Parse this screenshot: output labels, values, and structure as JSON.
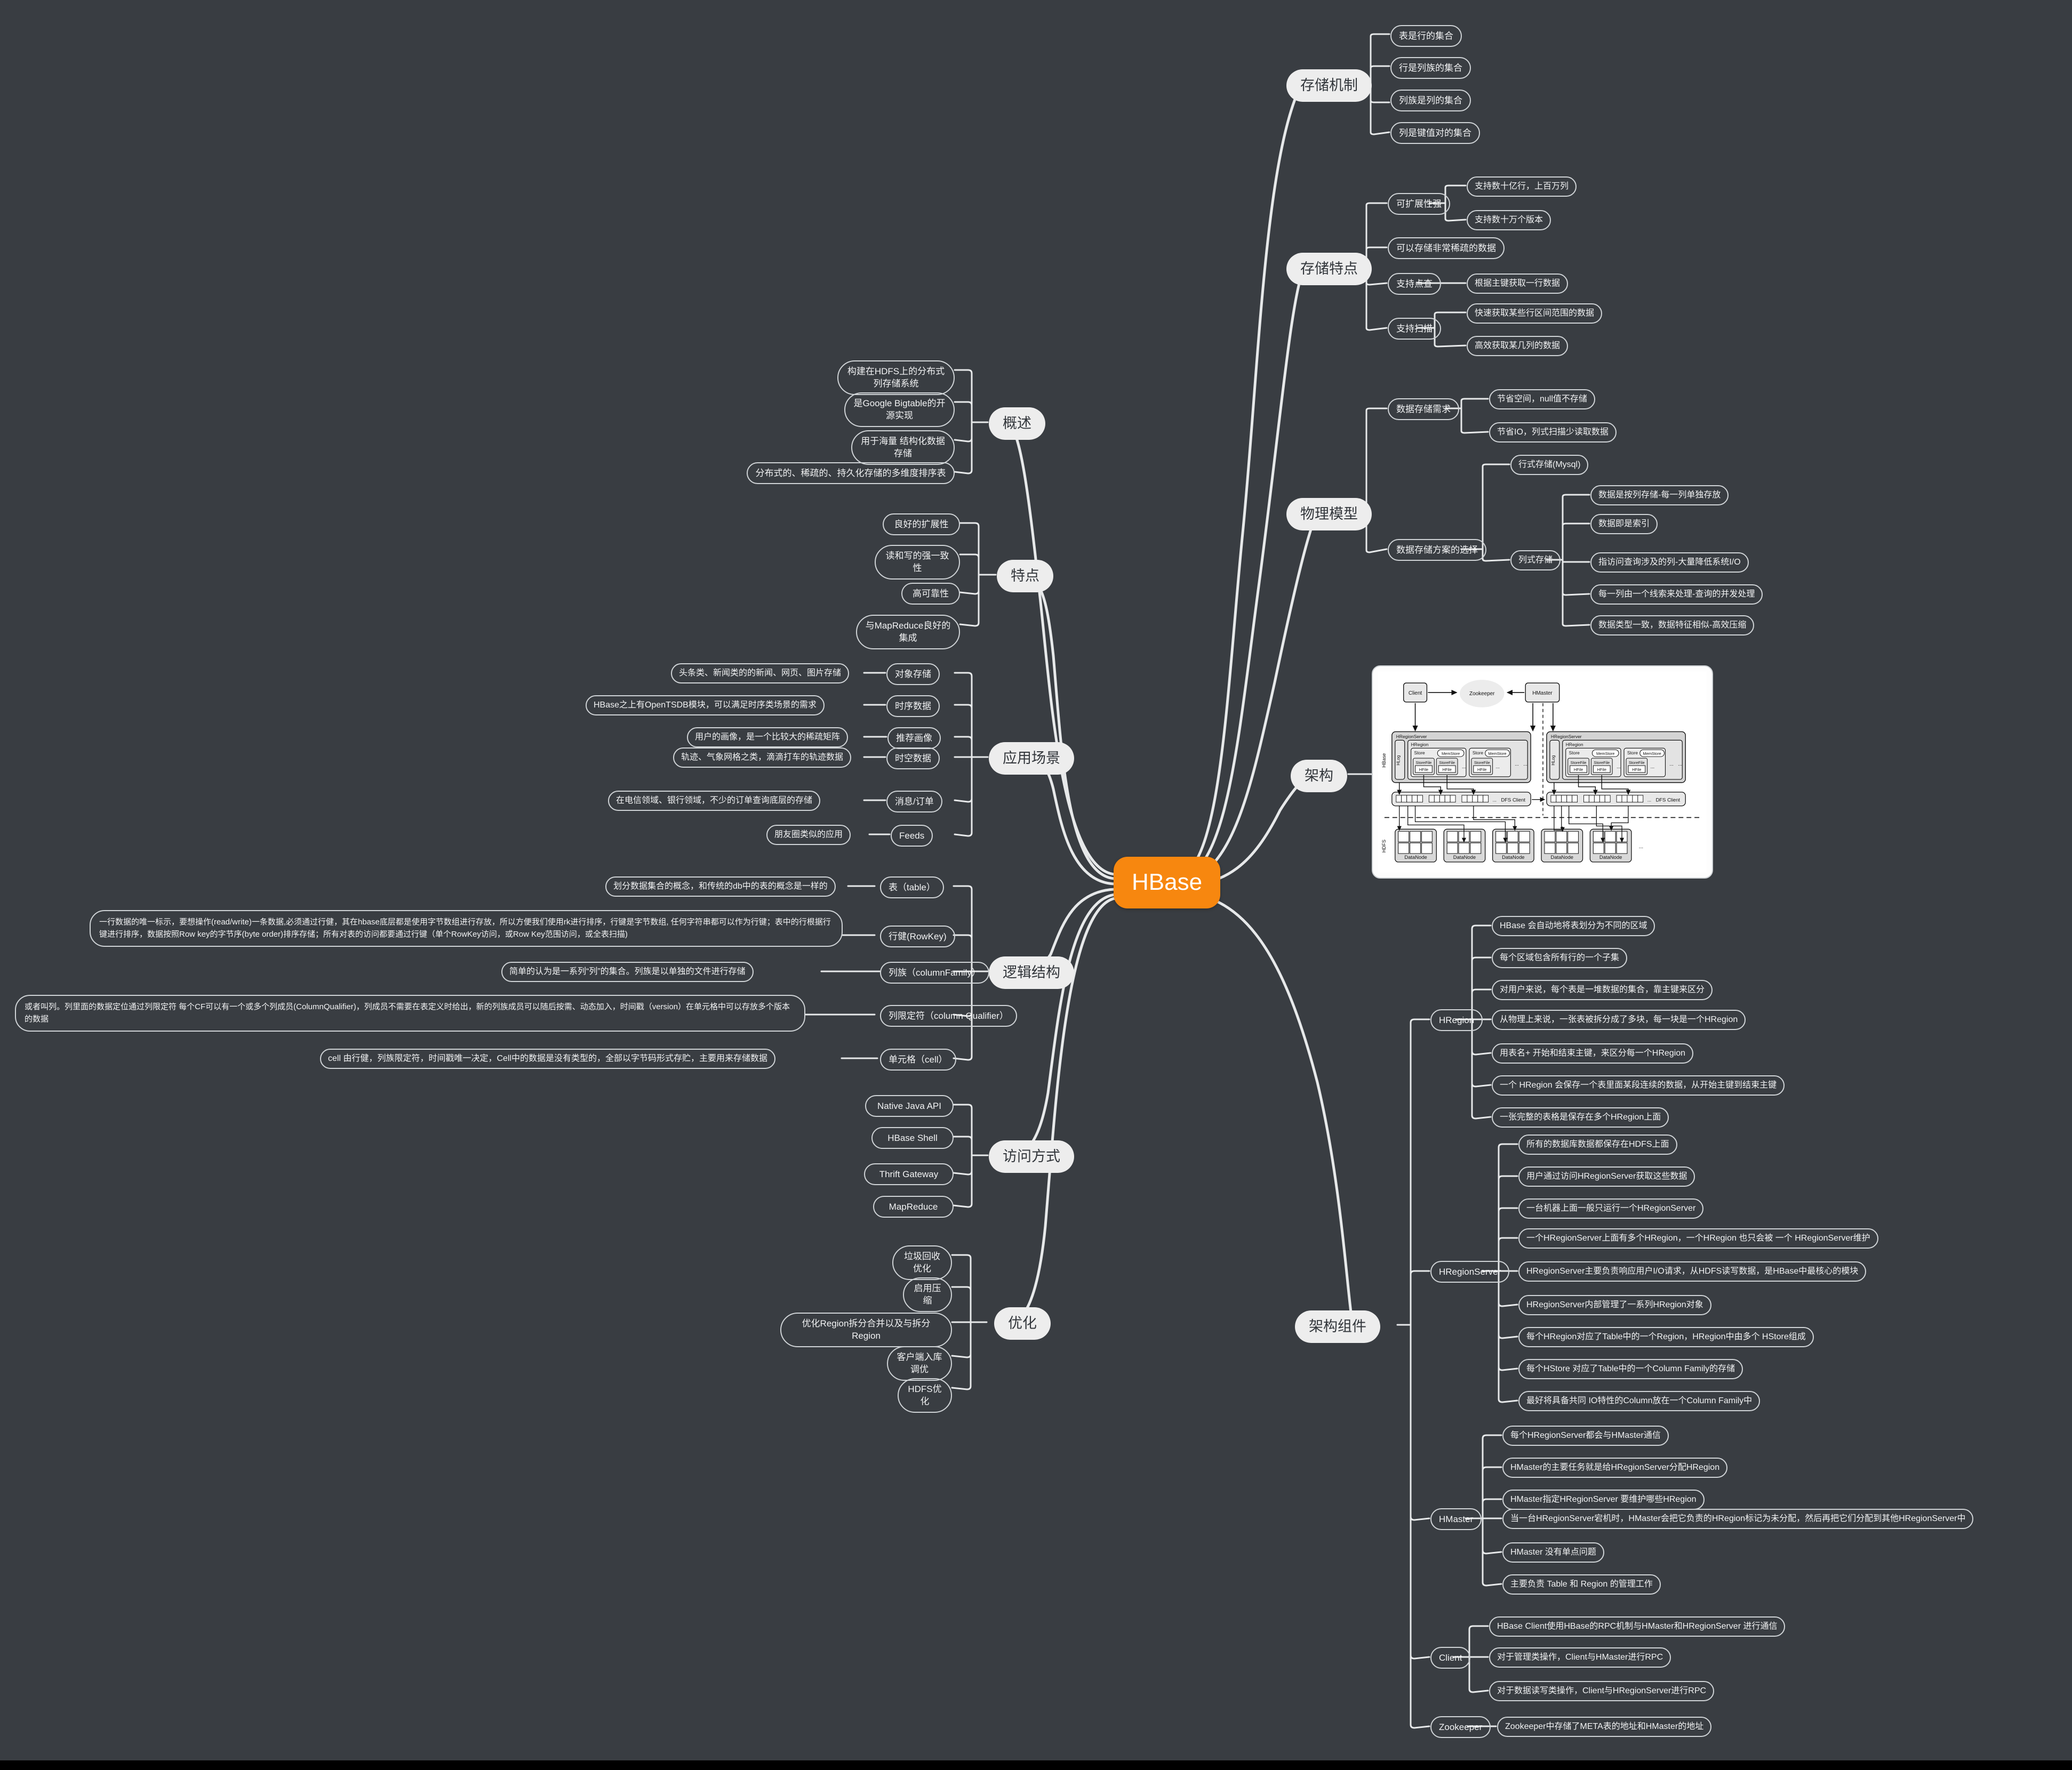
{
  "theme": {
    "canvas_bg": "#393d42",
    "root_color": "#f7870f",
    "level1_bg": "#ededed",
    "line_color": "#e7e9ea",
    "text_color": "#f2f3f4"
  },
  "root": {
    "label": "HBase"
  },
  "branches": {
    "storage_mechanism": {
      "label": "存储机制",
      "children": [
        "表是行的集合",
        "行是列族的集合",
        "列族是列的集合",
        "列是键值对的集合"
      ]
    },
    "storage_features": {
      "label": "存储特点",
      "children": [
        {
          "label": "可扩展性强",
          "children": [
            "支持数十亿行，上百万列",
            "支持数十万个版本"
          ]
        },
        {
          "label": "可以存储非常稀疏的数据",
          "children": []
        },
        {
          "label": "支持点查",
          "children": [
            "根据主键获取一行数据"
          ]
        },
        {
          "label": "支持扫描",
          "children": [
            "快速获取某些行区间范围的数据",
            "高效获取某几列的数据"
          ]
        }
      ]
    },
    "physical_model": {
      "label": "物理模型",
      "children": [
        {
          "label": "数据存储需求",
          "children": [
            "节省空间，null值不存储",
            "节省IO，列式扫描少读取数据"
          ]
        },
        {
          "label": "数据存储方案的选择",
          "children": [
            {
              "label": "行式存储(Mysql)",
              "children": []
            },
            {
              "label": "列式存储",
              "children": [
                "数据是按列存储-每一列单独存放",
                "数据即是索引",
                "指访问查询涉及的列-大量降低系统I/O",
                "每一列由一个线索来处理-查询的并发处理",
                "数据类型一致，数据特征相似-高效压缩"
              ]
            }
          ]
        }
      ]
    },
    "architecture": {
      "label": "架构",
      "diagram": {
        "name": "hbase-architecture-diagram",
        "nodes": [
          "Client",
          "Zookeeper",
          "HMaster",
          "HRegionServer",
          "HRegion",
          "HLog",
          "Store",
          "MemStore",
          "StoreFile",
          "HFile",
          "DFS Client",
          "DataNode"
        ],
        "side_labels": [
          "HBase",
          "HDFS"
        ],
        "ellipsis": "..."
      }
    },
    "architecture_components": {
      "label": "架构组件",
      "children": [
        {
          "label": "HRegion",
          "children": [
            "HBase 会自动地将表划分为不同的区域",
            "每个区域包含所有行的一个子集",
            "对用户来说，每个表是一堆数据的集合，靠主键来区分",
            "从物理上来说，一张表被拆分成了多块，每一块是一个HRegion",
            "用表名+ 开始和结束主键，来区分每一个HRegion",
            "一个 HRegion 会保存一个表里面某段连续的数据，从开始主键到结束主键",
            "一张完整的表格是保存在多个HRegion上面"
          ]
        },
        {
          "label": "HRegionServer",
          "children": [
            "所有的数据库数据都保存在HDFS上面",
            "用户通过访问HRegionServer获取这些数据",
            "一台机器上面一般只运行一个HRegionServer",
            "一个HRegionServer上面有多个HRegion，一个HRegion 也只会被 一个 HRegionServer维护",
            "HRegionServer主要负责响应用户I/O请求，从HDFS读写数据，是HBase中最核心的模块",
            "HRegionServer内部管理了一系列HRegion对象",
            "每个HRegion对应了Table中的一个Region，HRegion中由多个 HStore组成",
            "每个HStore 对应了Table中的一个Column Family的存储",
            "最好将具备共同 IO特性的Column放在一个Column Family中"
          ]
        },
        {
          "label": "HMaster",
          "children": [
            "每个HRegionServer都会与HMaster通信",
            "HMaster的主要任务就是给HRegionServer分配HRegion",
            "HMaster指定HRegionServer 要维护哪些HRegion",
            "当一台HRegionServer宕机时，HMaster会把它负责的HRegion标记为未分配，然后再把它们分配到其他HRegionServer中",
            "HMaster 没有单点问题",
            "主要负责 Table 和 Region 的管理工作"
          ]
        },
        {
          "label": "Client",
          "children": [
            "HBase Client使用HBase的RPC机制与HMaster和HRegionServer 进行通信",
            "对于管理类操作，Client与HMaster进行RPC",
            "对于数据读写类操作，Client与HRegionServer进行RPC"
          ]
        },
        {
          "label": "Zookeeper",
          "children": [
            "Zookeeper中存储了META表的地址和HMaster的地址"
          ]
        }
      ]
    },
    "overview": {
      "label": "概述",
      "children": [
        "构建在HDFS上的分布式列存储系统",
        "是Google Bigtable的开源实现",
        "用于海量 结构化数据存储",
        "分布式的、稀疏的、持久化存储的多维度排序表"
      ]
    },
    "features": {
      "label": "特点",
      "children": [
        "良好的扩展性",
        "读和写的强一致性",
        "高可靠性",
        "与MapReduce良好的集成"
      ]
    },
    "use_cases": {
      "label": "应用场景",
      "children": [
        {
          "label": "对象存储",
          "detail": "头条类、新闻类的的新闻、网页、图片存储"
        },
        {
          "label": "时序数据",
          "detail": "HBase之上有OpenTSDB模块，可以满足时序类场景的需求"
        },
        {
          "label": "推荐画像",
          "detail": "用户的画像，是一个比较大的稀疏矩阵"
        },
        {
          "label": "时空数据",
          "detail": "轨迹、气象网格之类，滴滴打车的轨迹数据"
        },
        {
          "label": "消息/订单",
          "detail": "在电信领域、银行领域，不少的订单查询底层的存储"
        },
        {
          "label": "Feeds",
          "detail": "朋友圈类似的应用"
        }
      ]
    },
    "logical_structure": {
      "label": "逻辑结构",
      "children": [
        {
          "label": "表（table）",
          "detail": "划分数据集合的概念，和传统的db中的表的概念是一样的"
        },
        {
          "label": "行健(RowKey)",
          "detail": "一行数据的唯一标示，要想操作(read/write)一条数据,必须通过行健，其在hbase底层都是使用字节数组进行存放，所以方便我们使用rk进行排序，行键是字节数组, 任何字符串都可以作为行键；表中的行根据行键进行排序，数据按照Row key的字节序(byte order)排序存储；所有对表的访问都要通过行键（单个RowKey访问，或Row Key范围访问，或全表扫描)"
        },
        {
          "label": "列族（columnFamily）",
          "detail": "简单的认为是一系列“列”的集合。列族是以单独的文件进行存储"
        },
        {
          "label": "列限定符（column Qualifier）",
          "detail": "或者叫列。列里面的数据定位通过列限定符 每个CF可以有一个或多个列成员(ColumnQualifier)，列成员不需要在表定义时给出，新的列族成员可以随后按需、动态加入，时间戳（version）在单元格中可以存放多个版本的数据"
        },
        {
          "label": "单元格（cell）",
          "detail": "cell 由行健，列族限定符，时间戳唯一决定，Cell中的数据是没有类型的，全部以字节码形式存贮，主要用来存储数据"
        }
      ]
    },
    "access_methods": {
      "label": "访问方式",
      "children": [
        "Native Java API",
        "HBase Shell",
        "Thrift Gateway",
        "MapReduce"
      ]
    },
    "optimization": {
      "label": "优化",
      "children": [
        "垃圾回收优化",
        "启用压缩",
        "优化Region拆分合并以及与拆分Region",
        "客户端入库调优",
        "HDFS优化"
      ]
    }
  }
}
